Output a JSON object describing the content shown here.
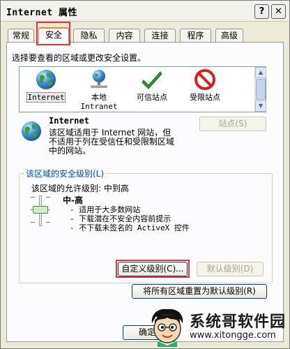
{
  "window": {
    "title": "Internet 属性",
    "help_label": "?",
    "close_label": "✕"
  },
  "tabs": [
    {
      "label": "常规"
    },
    {
      "label": "安全"
    },
    {
      "label": "隐私"
    },
    {
      "label": "内容"
    },
    {
      "label": "连接"
    },
    {
      "label": "程序"
    },
    {
      "label": "高级"
    }
  ],
  "security": {
    "instruction": "选择要查看的区域或更改安全设置。",
    "zones": [
      {
        "label": "Internet",
        "icon": "globe-icon"
      },
      {
        "label": "本地\nIntranet",
        "icon": "intranet-icon"
      },
      {
        "label": "可信站点",
        "icon": "checkmark-icon"
      },
      {
        "label": "受限站点",
        "icon": "restricted-icon"
      }
    ],
    "selected_zone": {
      "name": "Internet",
      "description": "该区域适用于 Internet 网站，但\n不适用于列在受信任和受限制区域\n中的网站。"
    },
    "sites_button": "站点(S)",
    "level_group_title": "该区域的安全级别(L)",
    "allowed_levels": "该区域的允许级别: 中到高",
    "level_name": "中-高",
    "level_items": [
      "- 适用于大多数网站",
      "- 下载潜在不安全内容前提示",
      "- 不下载未签名的 ActiveX 控件"
    ],
    "custom_level_button": "自定义级别(C)...",
    "default_level_button": "默认级别(D)",
    "reset_all_button": "将所有区域重置为默认级别(R)"
  },
  "footer": {
    "ok_button": "确定"
  },
  "watermark": {
    "text": "系统哥软件园",
    "url": "www.xitongge.com"
  },
  "colors": {
    "highlight": "#e8323a",
    "link_blue": "#0046d5",
    "tab_accent": "#e68b2c"
  }
}
